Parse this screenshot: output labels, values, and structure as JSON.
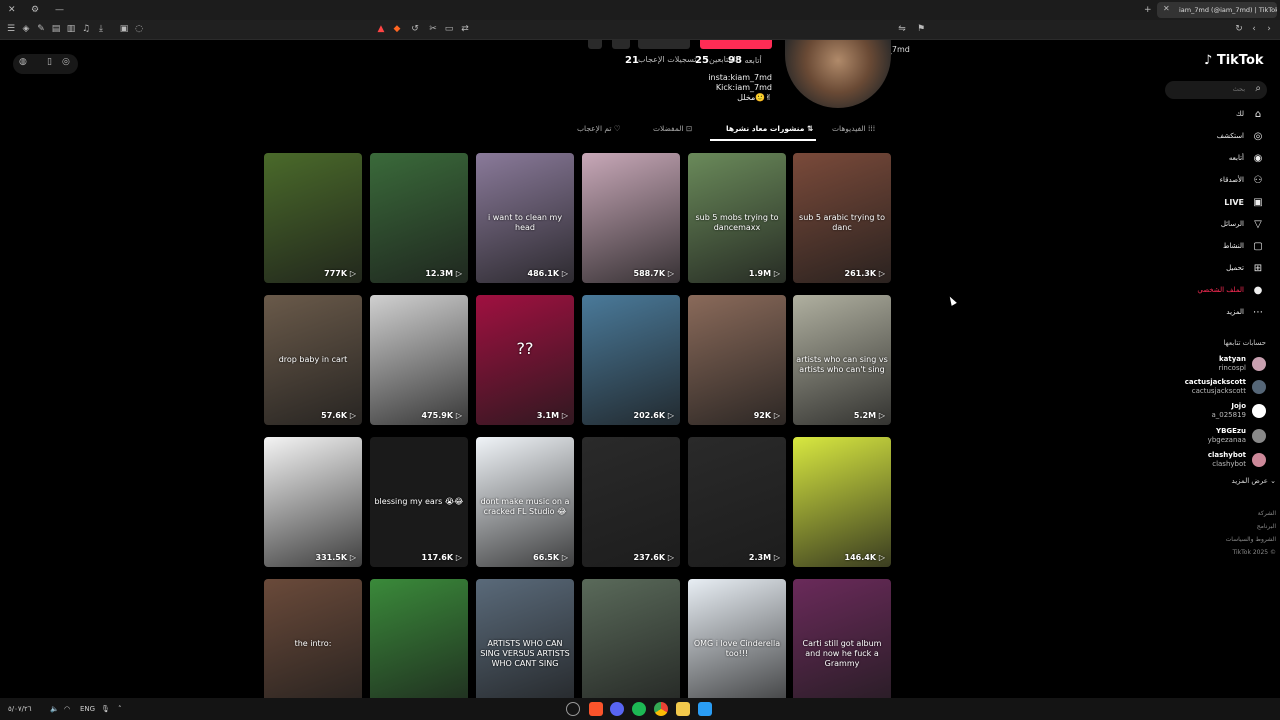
{
  "browser": {
    "tab_title": "iam_7md (@iam_7md) | TikTok",
    "url": "tiktok.com/@iam_7md"
  },
  "profile": {
    "stats": [
      {
        "label": "أتابعه",
        "value": "98"
      },
      {
        "label": "المتابعين",
        "value": "25"
      },
      {
        "label": "تسجيلات الإعجاب",
        "value": "21"
      }
    ],
    "bio": [
      "insta:kiam_7md",
      "Kick:iam_7md",
      "مخلل🙂✌"
    ],
    "tabs": [
      {
        "label": "الفيديوهات",
        "active": false
      },
      {
        "label": "منشورات معاد نشرها",
        "active": true
      },
      {
        "label": "المفضلات",
        "active": false
      },
      {
        "label": "تم الإعجاب",
        "active": false
      }
    ]
  },
  "videos": [
    {
      "views": "777K",
      "caption": "",
      "bg": "#4a6a2a"
    },
    {
      "views": "12.3M",
      "caption": "",
      "bg": "#3a6a3a"
    },
    {
      "views": "486.1K",
      "caption": "i want to clean my head",
      "bg": "#8a7a9a"
    },
    {
      "views": "588.7K",
      "caption": "",
      "bg": "#c8a8b8"
    },
    {
      "views": "1.9M",
      "caption": "sub 5 mobs trying to dancemaxx",
      "bg": "#6a8a5a"
    },
    {
      "views": "261.3K",
      "caption": "sub 5 arabic trying to danc",
      "bg": "#7a4a3a"
    },
    {
      "views": "57.6K",
      "caption": "drop baby in cart",
      "bg": "#6a5a4a"
    },
    {
      "views": "475.9K",
      "caption": "",
      "bg": "#d0d0d0"
    },
    {
      "views": "3.1M",
      "caption": "??",
      "bg": "#a01040"
    },
    {
      "views": "202.6K",
      "caption": "",
      "bg": "#4a7a9a"
    },
    {
      "views": "92K",
      "caption": "",
      "bg": "#8a6a5a"
    },
    {
      "views": "5.2M",
      "caption": "artists who can sing vs artists who can't sing",
      "bg": "#b0b0a0"
    },
    {
      "views": "331.5K",
      "caption": "",
      "bg": "#f4f4f4"
    },
    {
      "views": "117.6K",
      "caption": "blessing my ears 😭😂",
      "bg": "#1a1a1a"
    },
    {
      "views": "66.5K",
      "caption": "dont make music on a cracked FL Studio 😂",
      "bg": "#f0f4f8"
    },
    {
      "views": "237.6K",
      "caption": "",
      "bg": "#2a2a2a"
    },
    {
      "views": "2.3M",
      "caption": "",
      "bg": "#2a2a2a"
    },
    {
      "views": "146.4K",
      "caption": "",
      "bg": "#d8e840"
    },
    {
      "views": "",
      "caption": "the intro:",
      "bg": "#6a4a3a"
    },
    {
      "views": "",
      "caption": "",
      "bg": "#3a8a3a"
    },
    {
      "views": "",
      "caption": "ARTISTS WHO CAN SING VERSUS ARTISTS WHO CANT SING",
      "bg": "#5a6a7a"
    },
    {
      "views": "",
      "caption": "",
      "bg": "#5a6a5a"
    },
    {
      "views": "",
      "caption": "OMG i love Cinderella too!!!",
      "bg": "#e8eef4"
    },
    {
      "views": "",
      "caption": "Carti still got album and now he fuck a Grammy",
      "bg": "#6a2a5a"
    }
  ],
  "sidebar": {
    "logo": "TikTok",
    "search_placeholder": "بحث",
    "nav": [
      {
        "label": "لك",
        "icon": "home-icon",
        "glyph": "⌂"
      },
      {
        "label": "استكشف",
        "icon": "compass-icon",
        "glyph": "◎"
      },
      {
        "label": "أتابعه",
        "icon": "following-avatar-icon",
        "glyph": "◉"
      },
      {
        "label": "الأصدقاء",
        "icon": "friends-icon",
        "glyph": "⚇"
      },
      {
        "label": "LIVE",
        "icon": "live-icon",
        "glyph": "▣"
      },
      {
        "label": "الرسائل",
        "icon": "messages-icon",
        "glyph": "▽"
      },
      {
        "label": "النشاط",
        "icon": "activity-icon",
        "glyph": "▢"
      },
      {
        "label": "تحميل",
        "icon": "upload-icon",
        "glyph": "⊞"
      },
      {
        "label": "الملف الشخصي",
        "icon": "profile-avatar-icon",
        "glyph": "●"
      },
      {
        "label": "المزيد",
        "icon": "more-icon",
        "glyph": "⋯"
      }
    ],
    "following_heading": "حسابات تتابعها",
    "accounts": [
      {
        "name": "katyan",
        "handle": "rincospl",
        "color": "#c8a0b0"
      },
      {
        "name": "cactusjackscott",
        "handle": "cactusjackscott",
        "color": "#556677"
      },
      {
        "name": "Jojo",
        "handle": "a_025819",
        "color": "#ffffff"
      },
      {
        "name": "YBGEzu",
        "handle": "ybgezanaa",
        "color": "#888888"
      },
      {
        "name": "clashybot",
        "handle": "clashybot",
        "color": "#cc8899"
      }
    ],
    "see_more": "عرض المزيد",
    "footer": [
      "الشركة",
      "البرنامج",
      "الشروط والسياسات",
      "TikTok 2025 ©"
    ]
  },
  "taskbar": {
    "language": "ENG",
    "date": "٥/٠٧/٢٦"
  }
}
